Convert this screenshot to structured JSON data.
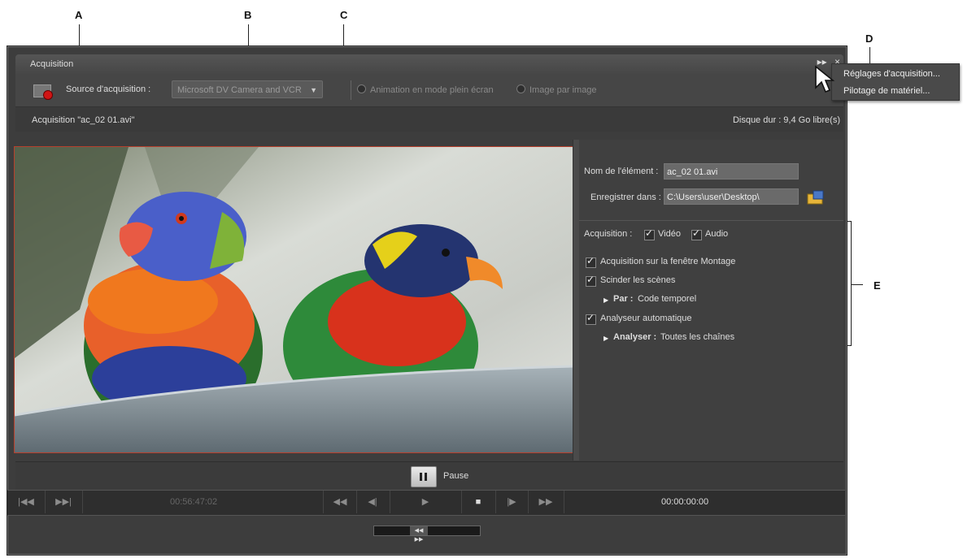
{
  "callouts": {
    "a": "A",
    "b": "B",
    "c": "C",
    "d": "D",
    "e": "E"
  },
  "window": {
    "title": "Acquisition",
    "close_glyph": "×",
    "menu_glyph": "▸▸"
  },
  "toolbar": {
    "source_label": "Source d'acquisition :",
    "source_value": "Microsoft DV Camera and VCR",
    "radio_fullscreen": "Animation en mode plein écran",
    "radio_frame": "Image par image"
  },
  "status": {
    "capturing": "Acquisition \"ac_02 01.avi\"",
    "disk_free": "Disque dur : 9,4 Go libre(s)"
  },
  "panel": {
    "clip_name_label": "Nom de l'élément :",
    "clip_name_value": "ac_02 01.avi",
    "save_in_label": "Enregistrer dans :",
    "save_in_value": "C:\\Users\\user\\Desktop\\",
    "capture_label": "Acquisition :",
    "video_label": "Vidéo",
    "audio_label": "Audio",
    "capture_to_timeline": "Acquisition sur la fenêtre Montage",
    "split_scenes": "Scinder les scènes",
    "by_label": "Par :",
    "by_value": "Code temporel",
    "auto_analyzer": "Analyseur automatique",
    "analyze_label": "Analyser :",
    "analyze_value": "Toutes les chaînes"
  },
  "pause": {
    "label": "Pause"
  },
  "transport": {
    "timecode_left": "00:56:47:02",
    "timecode_right": "00:00:00:00"
  },
  "menu": {
    "items": [
      "Réglages d'acquisition...",
      "Pilotage de matériel..."
    ]
  },
  "colors": {
    "accent_red": "#d01515",
    "preview_border": "#b8402c",
    "panel_bg": "#404040"
  }
}
